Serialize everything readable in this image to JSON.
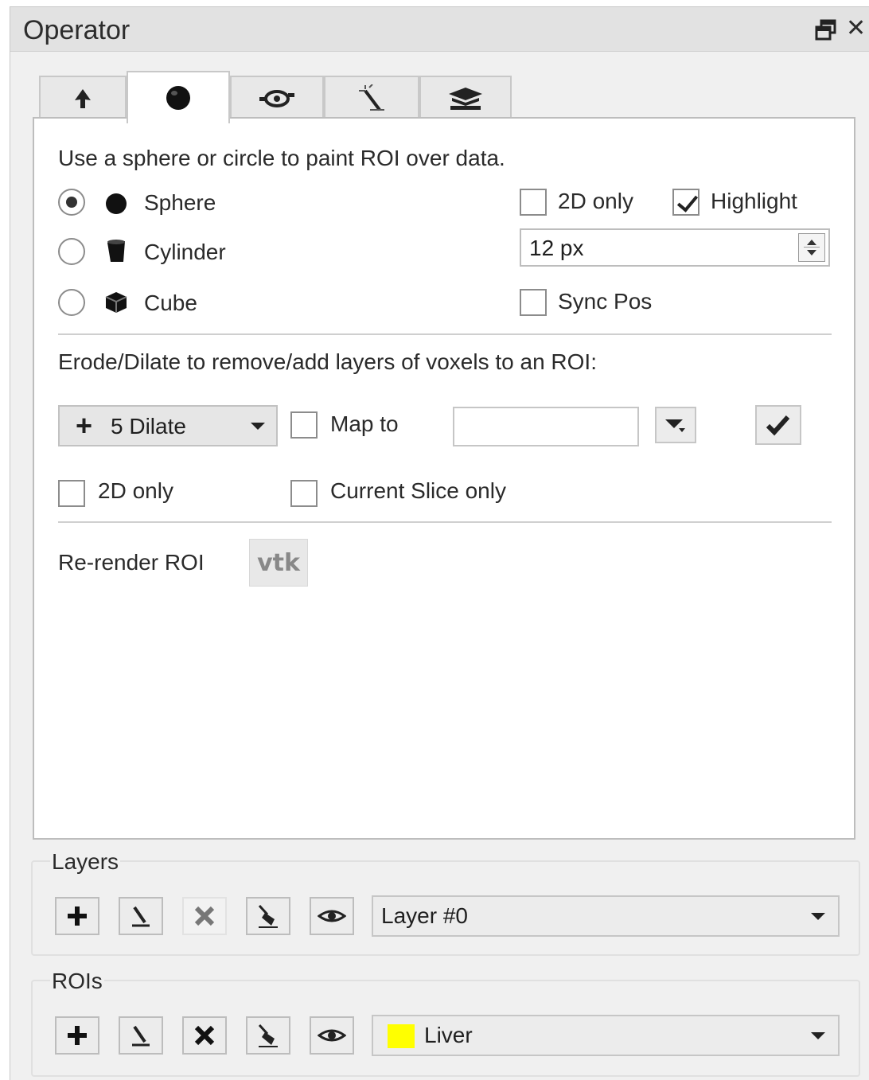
{
  "window": {
    "title": "Operator"
  },
  "tabs": [
    {
      "icon": "arrow-pointer-icon"
    },
    {
      "icon": "sphere-brush-icon",
      "active": true
    },
    {
      "icon": "eye-tool-icon"
    },
    {
      "icon": "magic-wand-icon"
    },
    {
      "icon": "layers-stack-icon"
    }
  ],
  "paint": {
    "description": "Use a sphere or circle to paint ROI over data.",
    "shapes": [
      {
        "label": "Sphere",
        "selected": true,
        "icon": "sphere-icon"
      },
      {
        "label": "Cylinder",
        "selected": false,
        "icon": "cylinder-icon"
      },
      {
        "label": "Cube",
        "selected": false,
        "icon": "cube-icon"
      }
    ],
    "two_d_only": {
      "label": "2D only",
      "checked": false
    },
    "highlight": {
      "label": "Highlight",
      "checked": true
    },
    "size": {
      "value": "12 px"
    },
    "sync_pos": {
      "label": "Sync Pos",
      "checked": false
    }
  },
  "erode_dilate": {
    "description": "Erode/Dilate to remove/add layers of voxels to an ROI:",
    "operation_label": "5 Dilate",
    "map_to": {
      "label": "Map to",
      "checked": false,
      "value": ""
    },
    "two_d_only": {
      "label": "2D only",
      "checked": false
    },
    "current_slice_only": {
      "label": "Current Slice only",
      "checked": false
    }
  },
  "rerender": {
    "label": "Re-render ROI",
    "button_label": "vtk"
  },
  "layers": {
    "title": "Layers",
    "selected": "Layer #0"
  },
  "rois": {
    "title": "ROIs",
    "selected": "Liver",
    "color": "#ffff00"
  },
  "colors": {
    "panel_bg": "#f0f0f0",
    "content_bg": "#ffffff",
    "border": "#bdbdbd"
  }
}
